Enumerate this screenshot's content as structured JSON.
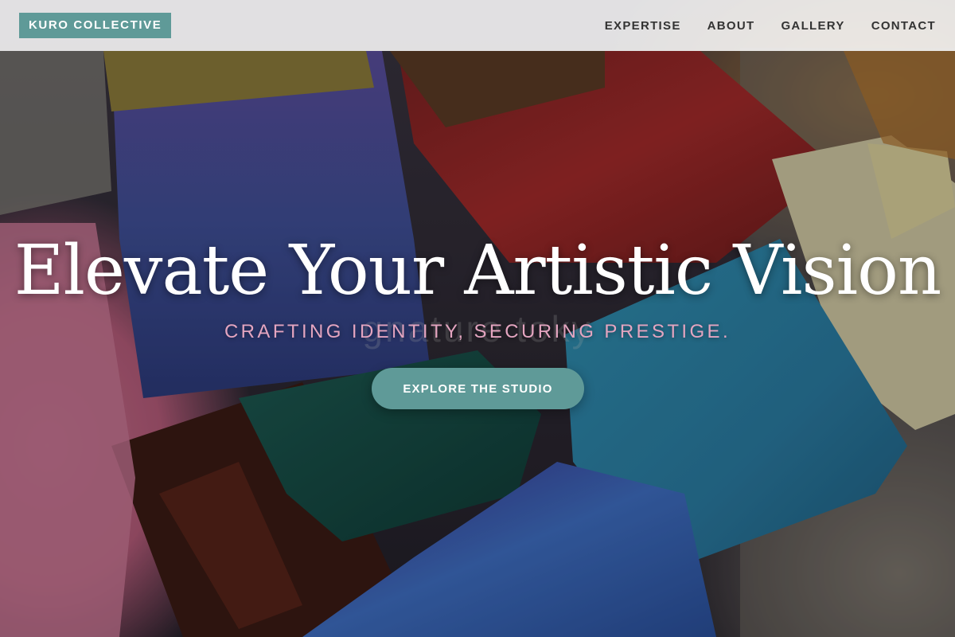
{
  "nav": {
    "brand": "KURO COLLECTIVE",
    "links": [
      "EXPERTISE",
      "ABOUT",
      "GALLERY",
      "CONTACT"
    ]
  },
  "hero": {
    "title": "Elevate Your Artistic Vision",
    "subtitle": "CRAFTING IDENTITY, SECURING PRESTIGE.",
    "cta_label": "EXPLORE THE STUDIO",
    "watermark": "gnature toky"
  },
  "colors": {
    "accent": "#5f9a98",
    "subtitle": "#e4a5c0",
    "title": "#ffffff",
    "nav_text": "#333333"
  }
}
